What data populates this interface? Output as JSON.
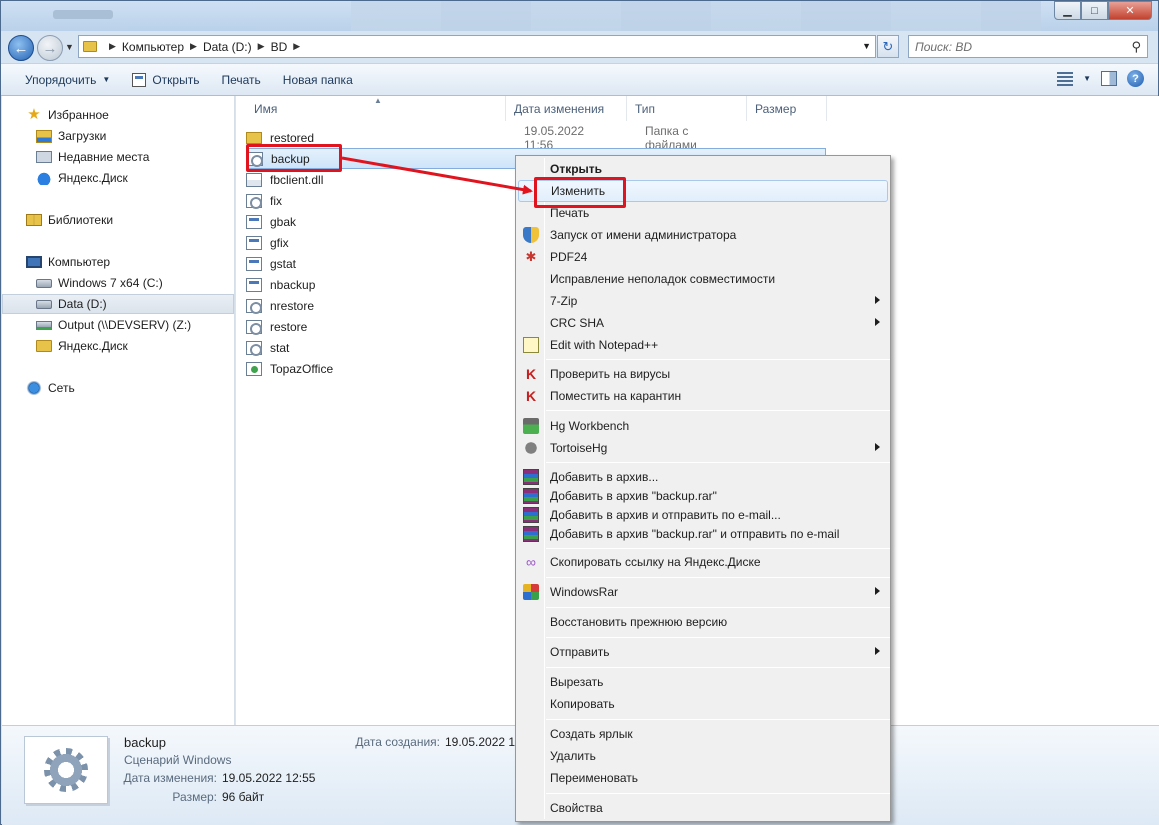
{
  "window": {
    "controls": {
      "minimize": "▁",
      "maximize": "□",
      "close": "✕"
    }
  },
  "address": {
    "segments": [
      "Компьютер",
      "Data (D:)",
      "BD"
    ],
    "search_placeholder": "Поиск: BD"
  },
  "toolbar": {
    "organize": "Упорядочить",
    "open": "Открыть",
    "print": "Печать",
    "new_folder": "Новая папка"
  },
  "nav": {
    "favorites": "Избранное",
    "downloads": "Загрузки",
    "recent": "Недавние места",
    "yandex1": "Яндекс.Диск",
    "libraries": "Библиотеки",
    "computer": "Компьютер",
    "drive_c": "Windows 7 x64 (C:)",
    "drive_d": "Data (D:)",
    "drive_z": "Output (\\\\DEVSERV) (Z:)",
    "yandex2": "Яндекс.Диск",
    "network": "Сеть"
  },
  "columns": {
    "name": "Имя",
    "date": "Дата изменения",
    "type": "Тип",
    "size": "Размер"
  },
  "files": [
    {
      "name": "restored",
      "date": "19.05.2022 11:56",
      "type": "Папка с файлами",
      "icon": "folder"
    },
    {
      "name": "backup",
      "icon": "script",
      "selected": true
    },
    {
      "name": "fbclient.dll",
      "icon": "dll"
    },
    {
      "name": "fix",
      "icon": "script"
    },
    {
      "name": "gbak",
      "icon": "exe"
    },
    {
      "name": "gfix",
      "icon": "exe"
    },
    {
      "name": "gstat",
      "icon": "exe"
    },
    {
      "name": "nbackup",
      "icon": "exe"
    },
    {
      "name": "nrestore",
      "icon": "script"
    },
    {
      "name": "restore",
      "icon": "script"
    },
    {
      "name": "stat",
      "icon": "script"
    },
    {
      "name": "TopazOffice",
      "icon": "topaz"
    }
  ],
  "menu": {
    "open": "Открыть",
    "edit": "Изменить",
    "print": "Печать",
    "run_as_admin": "Запуск от имени администратора",
    "pdf24": "PDF24",
    "compat": "Исправление неполадок совместимости",
    "zip7": "7-Zip",
    "crc": "CRC SHA",
    "npp": "Edit with Notepad++",
    "scan": "Проверить на вирусы",
    "quarantine": "Поместить на карантин",
    "hg_workbench": "Hg Workbench",
    "tortoisehg": "TortoiseHg",
    "add_archive": "Добавить в архив...",
    "add_rar": "Добавить в архив \"backup.rar\"",
    "add_email": "Добавить в архив и отправить по e-mail...",
    "add_rar_email": "Добавить в архив \"backup.rar\" и отправить по e-mail",
    "yandex_link": "Скопировать ссылку на Яндекс.Диске",
    "winrar": "WindowsRar",
    "restore_prev": "Восстановить прежнюю версию",
    "send_to": "Отправить",
    "cut": "Вырезать",
    "copy": "Копировать",
    "shortcut": "Создать ярлык",
    "delete": "Удалить",
    "rename": "Переименовать",
    "properties": "Свойства"
  },
  "details": {
    "name": "backup",
    "type": "Сценарий Windows",
    "modified_label": "Дата изменения:",
    "modified_value": "19.05.2022 12:55",
    "size_label": "Размер:",
    "size_value": "96 байт",
    "created_label": "Дата создания:",
    "created_value": "19.05.2022 10"
  },
  "colors": {
    "annotation": "#e0141e",
    "selection": "#cde4fa"
  }
}
